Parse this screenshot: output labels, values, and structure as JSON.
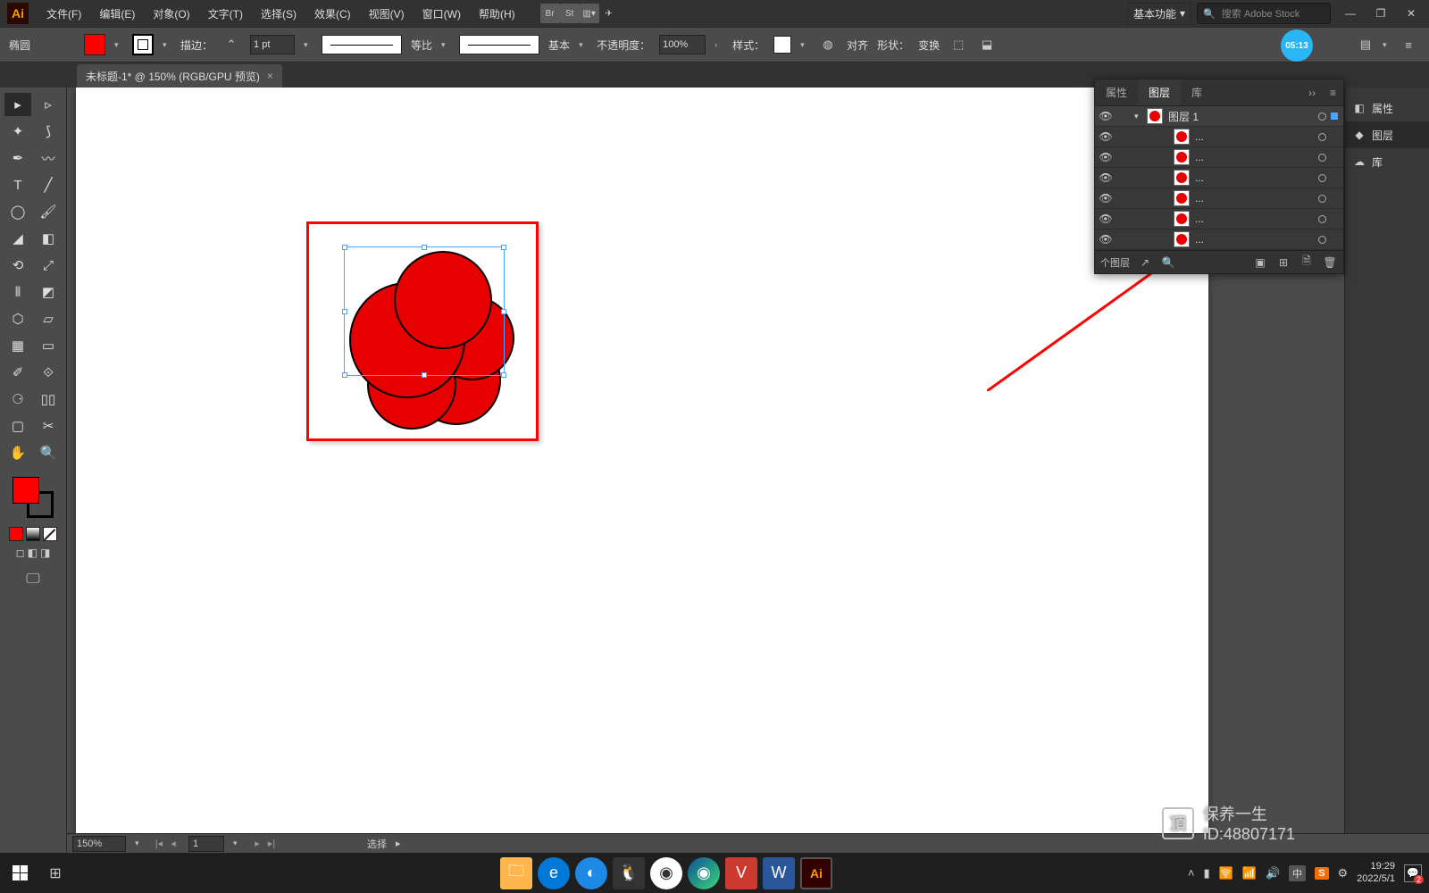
{
  "menubar": {
    "items": [
      "文件(F)",
      "编辑(E)",
      "对象(O)",
      "文字(T)",
      "选择(S)",
      "效果(C)",
      "视图(V)",
      "窗口(W)",
      "帮助(H)"
    ],
    "workspace": "基本功能",
    "search_placeholder": "搜索 Adobe Stock"
  },
  "controlbar": {
    "tool_name": "椭圆",
    "stroke_label": "描边：",
    "stroke_pt": "1 pt",
    "variable_label": "等比",
    "basic_label": "基本",
    "opacity_label": "不透明度：",
    "opacity_value": "100%",
    "style_label": "样式：",
    "align_label": "对齐",
    "shape_label": "形状：",
    "transform_label": "变换",
    "timer": "05:13"
  },
  "doc_tab": {
    "title": "未标题-1* @ 150% (RGB/GPU 预览)"
  },
  "right_dock": {
    "items": [
      {
        "icon": "◧",
        "label": "属性"
      },
      {
        "icon": "◆",
        "label": "图层"
      },
      {
        "icon": "☁",
        "label": "库"
      }
    ],
    "active_index": 1
  },
  "layers_panel": {
    "tabs": [
      "属性",
      "图层",
      "库"
    ],
    "active_tab": 1,
    "top_layer": "图层 1",
    "sublayers": [
      "...",
      "...",
      "...",
      "...",
      "...",
      "..."
    ],
    "footer_text": "个图层"
  },
  "statusbar": {
    "zoom": "150%",
    "page": "1",
    "mode": "选择"
  },
  "taskbar": {
    "time": "19:29",
    "date": "2022/5/1",
    "notif_count": "2",
    "ime": "中"
  },
  "watermark": {
    "line1": "保养一生",
    "line2": "ID:48807171"
  }
}
